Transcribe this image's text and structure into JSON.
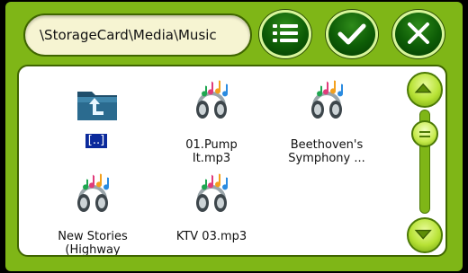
{
  "path_bar": {
    "value": "\\StorageCard\\Media\\Music"
  },
  "toolbar": {
    "list_button_icon": "list-icon",
    "ok_button_icon": "check-icon",
    "close_button_icon": "close-icon"
  },
  "files": [
    {
      "label": "[..]",
      "icon": "folder-up-icon",
      "type": "parent-folder"
    },
    {
      "label": "01.Pump It.mp3",
      "line1": "01.Pump",
      "line2": "It.mp3",
      "icon": "music-file-icon"
    },
    {
      "label": "Beethoven's Symphony ...",
      "line1": "Beethoven's",
      "line2": "Symphony ...",
      "icon": "music-file-icon"
    },
    {
      "label": "New Stories (Highway",
      "line1": "New Stories",
      "line2": "(Highway",
      "icon": "music-file-icon"
    },
    {
      "label": "KTV 03.mp3",
      "line1": "KTV 03.mp3",
      "icon": "music-file-icon"
    }
  ],
  "scrollbar": {
    "position": 0.0
  },
  "colors": {
    "frame": "#7fb617",
    "panel": "#ffffff",
    "button_dark": "#0d5c06",
    "selection": "#0b2a9c"
  }
}
